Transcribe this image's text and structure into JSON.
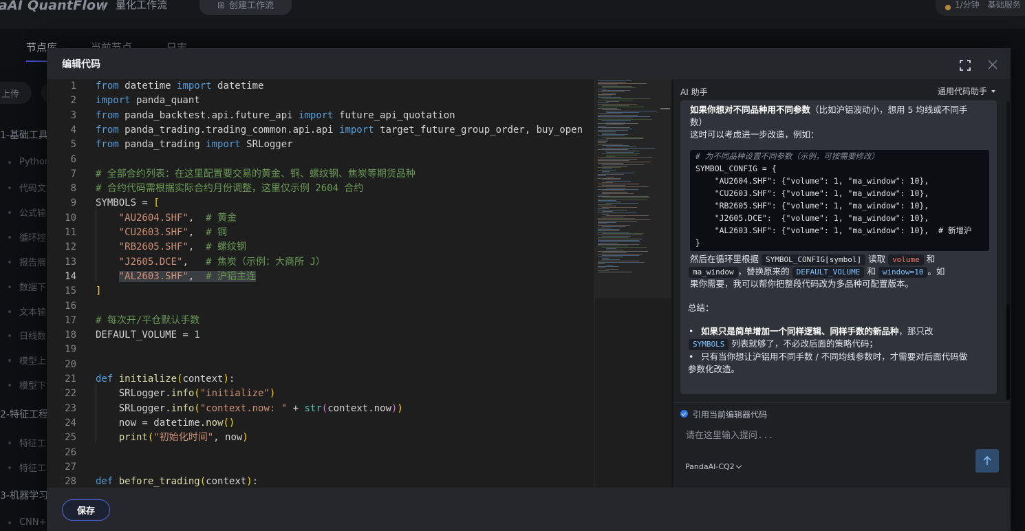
{
  "app": {
    "brand": "aAI QuantFlow",
    "subtitle": "量化工作流",
    "create_button": "创建工作流",
    "rate": "1/分钟",
    "plan": "基础服务"
  },
  "bg_tabs": [
    "节点库",
    "当前节点",
    "日志"
  ],
  "sidebar": {
    "upload": "上传",
    "groups": [
      {
        "label": "1-基础工具",
        "items": [
          "Python",
          "代码文",
          "公式输",
          "循环控",
          "报告展",
          "数据下",
          "文本输",
          "日线数",
          "模型上",
          "模型下"
        ]
      },
      {
        "label": "2-特征工程",
        "items": [
          "特征工",
          "特征工"
        ]
      },
      {
        "label": "3-机器学习",
        "items": [
          "CNN+"
        ]
      }
    ]
  },
  "modal": {
    "title": "编辑代码",
    "save_label": "保存",
    "current_line": 14
  },
  "code_lines": [
    {
      "n": 1,
      "html": "<span class=\"kw\">from</span> datetime <span class=\"kw\">import</span> datetime"
    },
    {
      "n": 2,
      "html": "<span class=\"kw\">import</span> panda_quant"
    },
    {
      "n": 3,
      "html": "<span class=\"kw\">from</span> panda_backtest.api.future_api <span class=\"kw\">import</span> future_api_quotation"
    },
    {
      "n": 4,
      "html": "<span class=\"kw\">from</span> panda_trading.trading_common.api.api <span class=\"kw\">import</span> target_future_group_order, buy_open"
    },
    {
      "n": 5,
      "html": "<span class=\"kw\">from</span> panda_trading <span class=\"kw\">import</span> SRLogger"
    },
    {
      "n": 6,
      "html": ""
    },
    {
      "n": 7,
      "html": "<span class=\"cm\"># 全部合约列表：在这里配置要交易的黄金、铜、螺纹钢、焦炭等期货品种</span>"
    },
    {
      "n": 8,
      "html": "<span class=\"cm\"># 合约代码需根据实际合约月份调整，这里仅示例 2604 合约</span>"
    },
    {
      "n": 9,
      "html": "SYMBOLS = <span class=\"br\">[</span>"
    },
    {
      "n": 10,
      "html": "    <span class=\"str\">\"AU2604.SHF\"</span>,  <span class=\"cm\"># 黄金</span>"
    },
    {
      "n": 11,
      "html": "    <span class=\"str\">\"CU2603.SHF\"</span>,  <span class=\"cm\"># 铜</span>"
    },
    {
      "n": 12,
      "html": "    <span class=\"str\">\"RB2605.SHF\"</span>,  <span class=\"cm\"># 螺纹钢</span>"
    },
    {
      "n": 13,
      "html": "    <span class=\"str\">\"J2605.DCE\"</span>,   <span class=\"cm\"># 焦炭（示例：大商所 J）</span>"
    },
    {
      "n": 14,
      "html": "    <span class=\"str\">\"AL2603.SHF\"</span>,  <span class=\"cm\"># 沪铝主连</span>"
    },
    {
      "n": 15,
      "html": "<span class=\"br\">]</span>"
    },
    {
      "n": 16,
      "html": ""
    },
    {
      "n": 17,
      "html": "<span class=\"cm\"># 每次开/平仓默认手数</span>"
    },
    {
      "n": 18,
      "html": "DEFAULT_VOLUME = <span style=\"color:#b5cea8\">1</span>"
    },
    {
      "n": 19,
      "html": ""
    },
    {
      "n": 20,
      "html": ""
    },
    {
      "n": 21,
      "html": "<span class=\"kw\">def</span> <span class=\"fn\">initialize</span><span class=\"br\">(</span>context<span class=\"br\">)</span>:"
    },
    {
      "n": 22,
      "html": "    SRLogger.<span class=\"fn\">info</span><span class=\"br\">(</span><span class=\"str\">\"initialize\"</span><span class=\"br\">)</span>"
    },
    {
      "n": 23,
      "html": "    SRLogger.<span class=\"fn\">info</span><span class=\"br\">(</span><span class=\"str\">\"context.now: \"</span> + <span class=\"bi\">str</span><span class=\"br2\">(</span>context.now<span class=\"br2\">)</span><span class=\"br\">)</span>"
    },
    {
      "n": 24,
      "html": "    now = datetime.<span class=\"fn\">now</span><span class=\"br\">()</span>"
    },
    {
      "n": 25,
      "html": "    <span class=\"fn\">print</span><span class=\"br\">(</span><span class=\"str\">\"初始化时间\"</span>, now<span class=\"br\">)</span>"
    },
    {
      "n": 26,
      "html": ""
    },
    {
      "n": 27,
      "html": ""
    },
    {
      "n": 28,
      "html": "<span class=\"kw\">def</span> <span class=\"fn\">before_trading</span><span class=\"br\">(</span>context<span class=\"br\">)</span>:"
    }
  ],
  "ai": {
    "title": "AI 助手",
    "assistant_select": "通用代码助手",
    "msg_intro_bold": "如果你想对不同品种用不同参数",
    "msg_intro_rest": "（比如沪铝波动小，想用 5 均线或不同手",
    "msg_intro_line2": "数）",
    "msg_line3": "这时可以考虑进一步改造，例如：",
    "code_block": [
      "# 为不同品种设置不同参数（示例，可按需要修改）",
      "SYMBOL_CONFIG = {",
      "    \"AU2604.SHF\": {\"volume\": 1, \"ma_window\": 10},",
      "    \"CU2603.SHF\": {\"volume\": 1, \"ma_window\": 10},",
      "    \"RB2605.SHF\": {\"volume\": 1, \"ma_window\": 10},",
      "    \"J2605.DCE\":  {\"volume\": 1, \"ma_window\": 10},",
      "    \"AL2603.SHF\": {\"volume\": 1, \"ma_window\": 10},  # 新增沪",
      "}"
    ],
    "after_code_1a": "然后在循环里根据",
    "after_code_code1": "SYMBOL_CONFIG[symbol]",
    "after_code_1b": "读取",
    "after_code_code2": "volume",
    "after_code_1c": "和",
    "after_code_code3": "ma_window",
    "after_code_2a": "，替换原来的",
    "after_code_code4": "DEFAULT_VOLUME",
    "after_code_2b": "和",
    "after_code_code5": "window=10",
    "after_code_2c": "。如",
    "after_code_3": "果你需要，我可以帮你把整段代码改为多品种可配置版本。",
    "summary": "总结：",
    "bullet1_bold": "如果只是简单增加一个同样逻辑、同样手数的新品种",
    "bullet1_rest": "，那只改",
    "bullet1_code": "SYMBOLS",
    "bullet1_rest2": "列表就够了，不必改后面的策略代码；",
    "bullet2_line1": "只有当你想让沪铝用不同手数 / 不同均线参数时，才需要对后面代码做",
    "bullet2_line2": "参数化改造。",
    "ref_label": "引用当前编辑器代码",
    "input_placeholder": "请在这里输入提问...",
    "model": "PandaAI-CQ2"
  },
  "colors": {
    "accent": "#5268e2",
    "modal_bg": "#26272c",
    "editor_bg": "#1e1e1e",
    "send_button": "#2e4c6d"
  }
}
